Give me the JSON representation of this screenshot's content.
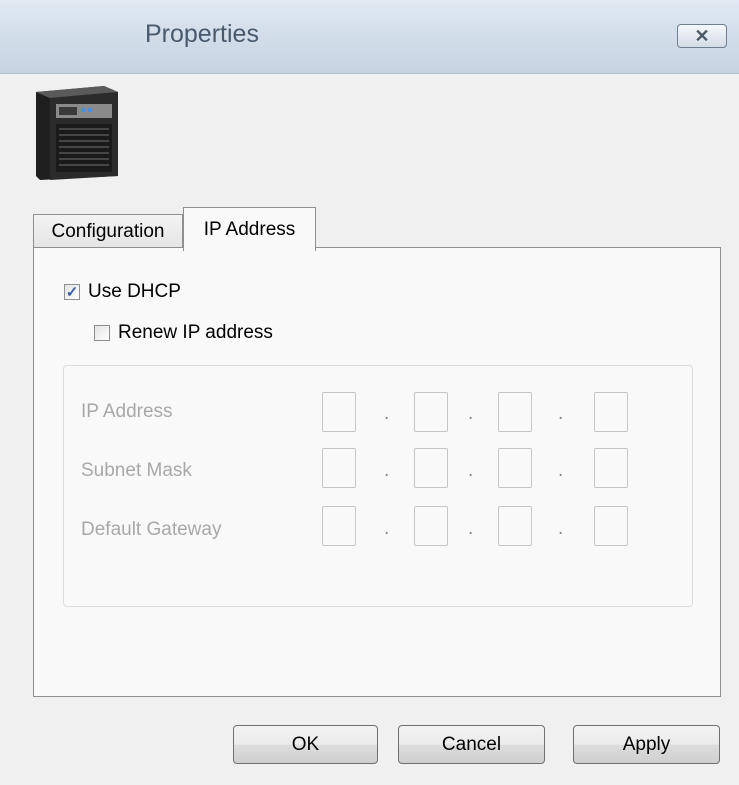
{
  "window": {
    "title": "Properties",
    "close_symbol": "✕"
  },
  "device_icon": "nas-device-icon",
  "tabs": [
    {
      "label": "Configuration",
      "active": false
    },
    {
      "label": "IP Address",
      "active": true
    }
  ],
  "options": {
    "use_dhcp": {
      "label": "Use DHCP",
      "checked": true,
      "check_glyph": "✓"
    },
    "renew_ip": {
      "label": "Renew IP address",
      "checked": false
    }
  },
  "ip_fields": {
    "ip_address": {
      "label": "IP Address",
      "octets": [
        "",
        "",
        "",
        ""
      ]
    },
    "subnet_mask": {
      "label": "Subnet Mask",
      "octets": [
        "",
        "",
        "",
        ""
      ]
    },
    "default_gateway": {
      "label": "Default Gateway",
      "octets": [
        "",
        "",
        "",
        ""
      ]
    },
    "separator": "."
  },
  "buttons": {
    "ok": "OK",
    "cancel": "Cancel",
    "apply": "Apply"
  },
  "colors": {
    "accent_check": "#3a5fa8",
    "disabled_text": "#a8a8a8"
  }
}
